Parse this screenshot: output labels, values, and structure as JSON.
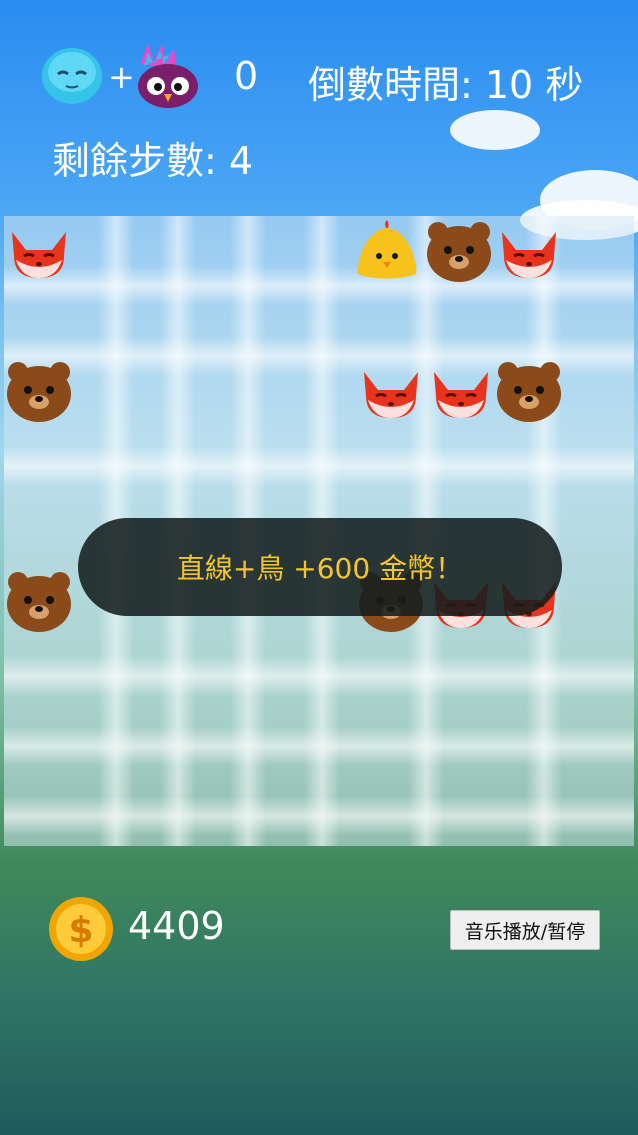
{
  "hud": {
    "combo_plus": "+",
    "score": "0",
    "countdown": "倒數時間: 10 秒",
    "steps": "剩餘步數: 4",
    "combo_icons": [
      "blue-monster-icon",
      "rainbow-owl-icon"
    ]
  },
  "board": {
    "pieces": [
      {
        "type": "fox"
      },
      {
        "type": "chick"
      },
      {
        "type": "bear"
      },
      {
        "type": "fox"
      },
      {
        "type": "bear"
      },
      {
        "type": "fox"
      },
      {
        "type": "fox"
      },
      {
        "type": "bear"
      },
      {
        "type": "bear"
      },
      {
        "type": "bear"
      },
      {
        "type": "fox"
      },
      {
        "type": "fox"
      }
    ]
  },
  "toast": {
    "message": "直線+鳥 +600 金幣！"
  },
  "footer": {
    "coin_icon": "dollar-coin-icon",
    "coins": "4409",
    "music_button": "音乐播放/暂停"
  },
  "colors": {
    "sky": "#2a8cf0",
    "toast_text": "#f4c430",
    "fox": "#e8341c",
    "bear": "#8a4a1a",
    "chick": "#f7c21b"
  }
}
